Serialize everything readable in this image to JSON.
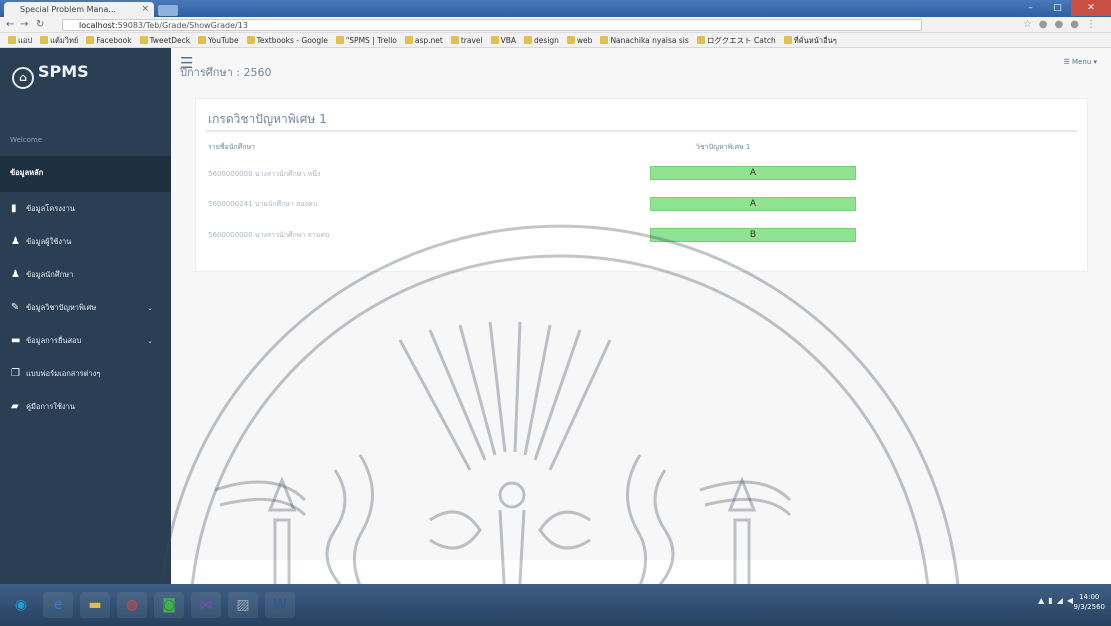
{
  "browser": {
    "tab_title": "Special Problem Mana...",
    "address_host": "localhost",
    "address_path": ":59083/Teb/Grade/ShowGrade/13",
    "bookmarks": [
      {
        "label": "แอป"
      },
      {
        "label": "แต้มวิทย์"
      },
      {
        "label": "Facebook"
      },
      {
        "label": "TweetDeck"
      },
      {
        "label": "YouTube"
      },
      {
        "label": "Textbooks - Google"
      },
      {
        "label": "\"SPMS | Trello"
      },
      {
        "label": "asp.net"
      },
      {
        "label": "travel"
      },
      {
        "label": "VBA"
      },
      {
        "label": "design"
      },
      {
        "label": "web"
      },
      {
        "label": "Nanachika nyaisa sis"
      },
      {
        "label": "ログクエスト Catch"
      },
      {
        "label": "ที่คั่นหน้าอื่นๆ"
      }
    ]
  },
  "sidebar": {
    "brand": "SPMS",
    "welcome": "Welcome",
    "section": "ข้อมูลหลัก",
    "items": [
      {
        "label": "ข้อมูลโครงงาน",
        "icon": "bookmark-icon",
        "has_arrow": false
      },
      {
        "label": "ข้อมูลผู้ใช้งาน",
        "icon": "user-icon",
        "has_arrow": false
      },
      {
        "label": "ข้อมูลนักศึกษา",
        "icon": "user-icon",
        "has_arrow": false
      },
      {
        "label": "ข้อมูลวิชาปัญหาพิเศษ",
        "icon": "pencil-icon",
        "has_arrow": true
      },
      {
        "label": "ข้อมูลการยื่นสอบ",
        "icon": "folder-icon",
        "has_arrow": true
      },
      {
        "label": "แบบฟอร์มเอกสารต่างๆ",
        "icon": "copy-icon",
        "has_arrow": false
      },
      {
        "label": "คู่มือการใช้งาน",
        "icon": "book-icon",
        "has_arrow": false
      }
    ]
  },
  "topnav": {
    "menu_label": "☰ Menu ▾"
  },
  "page": {
    "title": "ปีการศึกษา : 2560"
  },
  "panel": {
    "title": "เกรดวิชาปัญหาพิเศษ 1",
    "col_student": "รายชื่อนักศึกษา",
    "col_grade": "วิชาปัญหาพิเศษ 1",
    "rows": [
      {
        "name": "5600000000 นางสาวนักศึกษา หนึ่ง",
        "grade": "A"
      },
      {
        "name": "5600000241 นายนักศึกษา สองคน",
        "grade": "A"
      },
      {
        "name": "5600000000 นางสาวนักศึกษา สามคน",
        "grade": "B"
      }
    ]
  },
  "taskbar": {
    "apps": [
      {
        "icon": "start-icon"
      },
      {
        "icon": "ie-icon"
      },
      {
        "icon": "explorer-icon"
      },
      {
        "icon": "chrome-icon"
      },
      {
        "icon": "line-icon"
      },
      {
        "icon": "visual-studio-icon"
      },
      {
        "icon": "paint-icon"
      },
      {
        "icon": "word-icon"
      }
    ],
    "clock_time": "14:00",
    "clock_date": "9/3/2560"
  },
  "colors": {
    "sidebar": "#2a3f54",
    "grade_fill": "#8fe28f",
    "muted_text": "#73879c"
  }
}
